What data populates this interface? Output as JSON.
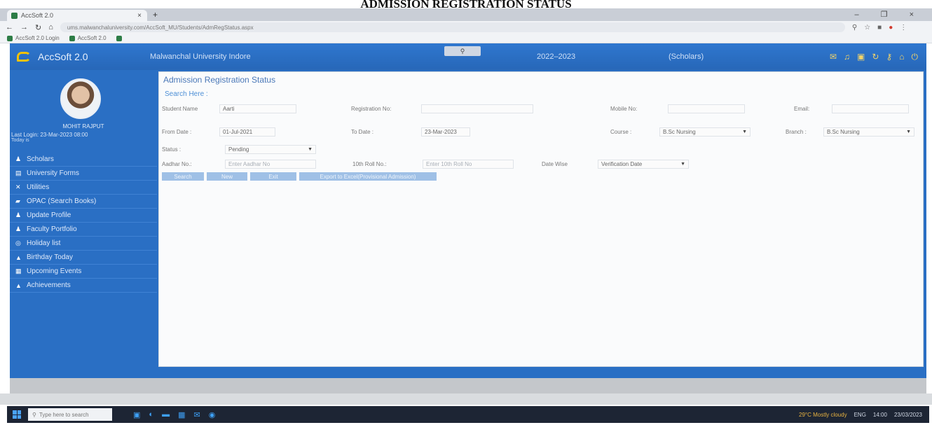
{
  "document": {
    "heading": "ADMISSION REGISTRATION STATUS"
  },
  "browser": {
    "tab_title": "AccSoft 2.0",
    "tab_close": "×",
    "new_tab": "+",
    "window_controls": "–  ❐  ×",
    "url": "ums.malwanchaluniversity.com/AccSoft_MU/Students/AdmRegStatus.aspx",
    "bookmarks": [
      "AccSoft 2.0 Login",
      "AccSoft 2.0"
    ]
  },
  "header": {
    "app_name": "AccSoft 2.0",
    "university": "Malwanchal University Indore",
    "session": "2022–2023",
    "role": "(Scholars)"
  },
  "sidebar": {
    "user_name": "MOHIT RAJPUT",
    "last_login_label": "Last Login:",
    "last_login_value": "23-Mar-2023 08:00",
    "today_label": "Today is",
    "menu": [
      {
        "label": "Scholars",
        "icon": "user-icon"
      },
      {
        "label": "University Forms",
        "icon": "form-icon"
      },
      {
        "label": "Utilities",
        "icon": "tools-icon"
      },
      {
        "label": "OPAC (Search Books)",
        "icon": "book-icon"
      },
      {
        "label": "Update Profile",
        "icon": "user-icon"
      },
      {
        "label": "Faculty Portfolio",
        "icon": "user-icon"
      },
      {
        "label": "Holiday list",
        "icon": "globe-icon"
      },
      {
        "label": "Birthday Today",
        "icon": "cake-icon"
      },
      {
        "label": "Upcoming Events",
        "icon": "calendar-icon"
      },
      {
        "label": "Achievements",
        "icon": "thumbs-up-icon"
      }
    ]
  },
  "main": {
    "title": "Admission Registration Status",
    "search_here": "Search Here :",
    "fields": {
      "student_name_label": "Student Name",
      "student_name_value": "Aarti",
      "registration_no_label": "Registration No:",
      "registration_no_value": "",
      "mobile_no_label": "Mobile No:",
      "mobile_no_value": "",
      "email_label": "Email:",
      "email_value": "",
      "from_date_label": "From Date :",
      "from_date_value": "01-Jul-2021",
      "to_date_label": "To Date :",
      "to_date_value": "23-Mar-2023",
      "course_label": "Course :",
      "course_value": "B.Sc Nursing",
      "branch_label": "Branch :",
      "branch_value": "B.Sc Nursing",
      "status_label": "Status :",
      "status_value": "Pending",
      "aadhar_label": "Aadhar No.:",
      "aadhar_placeholder": "Enter Aadhar No",
      "roll_label": "10th Roll No.:",
      "roll_placeholder": "Enter 10th Roll No",
      "date_wise_label": "Date Wise",
      "date_wise_value": "Verification Date"
    },
    "buttons": {
      "search": "Search",
      "new": "New",
      "exit": "Exit",
      "export": "Export to Excel(Provisional Admission)"
    }
  },
  "taskbar": {
    "search_placeholder": "Type here to search",
    "weather": "29°C Mostly cloudy",
    "lang": "ENG",
    "time": "14:00",
    "date": "23/03/2023"
  },
  "colors": {
    "brand_blue": "#2a6fc4",
    "accent_link": "#4d8fd6",
    "button": "#9fc0e6"
  }
}
